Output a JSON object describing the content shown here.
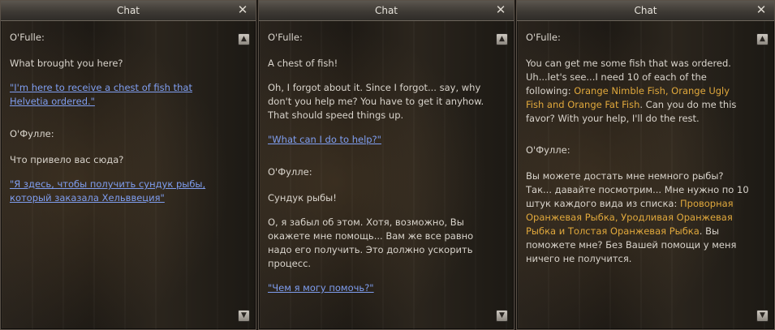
{
  "windows": [
    {
      "title": "Chat",
      "close_label": "✕",
      "speaker_en": "O'Fulle:",
      "line_en_1": "What brought you here?",
      "link_en": "\"I'm here to receive a chest of fish that Helvetia ordered.\"",
      "speaker_ru": "О'Фулле:",
      "line_ru_1": "Что привело вас сюда?",
      "link_ru": "\"Я здесь, чтобы получить сундук рыбы, который заказала Хельввеция\""
    },
    {
      "title": "Chat",
      "close_label": "✕",
      "speaker_en": "O'Fulle:",
      "line_en_1": "A chest of fish!",
      "line_en_2": "Oh, I forgot about it. Since I forgot... say, why don't you help me? You have to get it anyhow. That should speed things up.",
      "link_en": "\"What can I do to help?\"",
      "speaker_ru": "О'Фулле:",
      "line_ru_1": "Сундук рыбы!",
      "line_ru_2": "О, я забыл об этом. Хотя, возможно, Вы окажете мне помощь... Вам же все равно надо его получить. Это должно ускорить процесс.",
      "link_ru": "\"Чем я могу помочь?\""
    },
    {
      "title": "Chat",
      "close_label": "✕",
      "speaker_en": "O'Fulle:",
      "en_text_a": "You can get me some fish that was ordered. Uh...let's see...I need 10 of each of the following: ",
      "en_highlight": "Orange Nimble Fish, Orange Ugly Fish and Orange Fat Fish",
      "en_text_b": ". Can you do me this favor? With your help, I'll do the rest.",
      "speaker_ru": "О'Фулле:",
      "ru_text_a": "Вы можете достать мне немного рыбы? Так... давайте посмотрим... Мне нужно по 10 штук каждого вида из списка: ",
      "ru_highlight": "Проворная Оранжевая Рыбка, Уродливая Оранжевая Рыбка и Толстая Оранжевая Рыбка",
      "ru_text_b": ". Вы поможете мне? Без Вашей помощи у меня ничего не получится."
    }
  ],
  "scroll_up_icon": "▲",
  "scroll_down_icon": "▼",
  "colors": {
    "link": "#7f9ef0",
    "highlight": "#e0a83c",
    "text": "#d9d4cc",
    "title_text": "#e8e4dc"
  }
}
